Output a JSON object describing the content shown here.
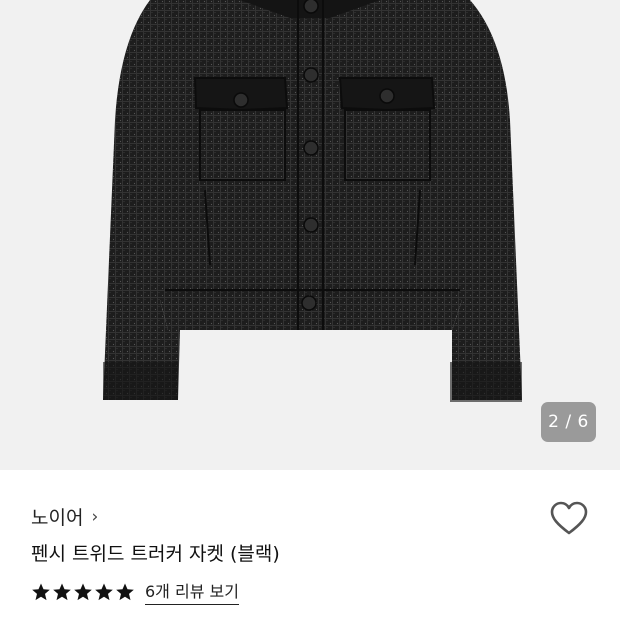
{
  "gallery": {
    "counter": "2 / 6",
    "image_subject": "black-tweed-trucker-jacket"
  },
  "product": {
    "brand": "노이어",
    "title": "펜시 트위드 트러커 자켓 (블랙)",
    "rating_stars": 5,
    "review_link": "6개 리뷰 보기"
  },
  "colors": {
    "gallery_bg": "#f1f1f1",
    "jacket": "#1c1c1c",
    "counter_bg": "#7a7a7a"
  },
  "icons": [
    "chevron-right-icon",
    "heart-icon",
    "star-icon"
  ]
}
